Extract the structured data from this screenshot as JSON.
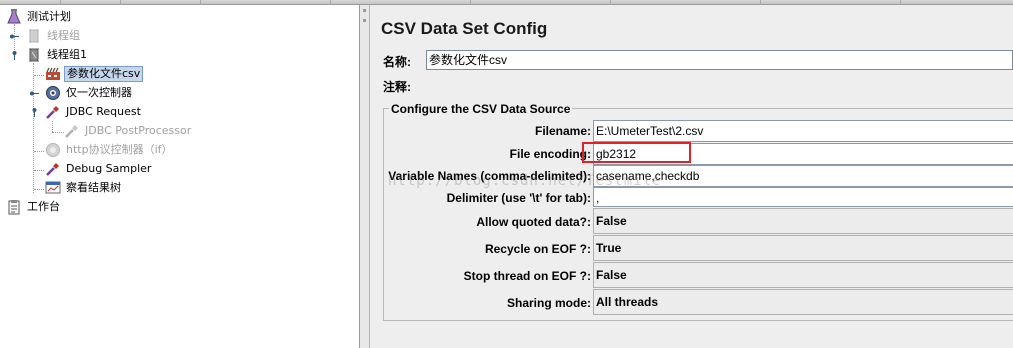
{
  "tree": {
    "nodes": [
      {
        "label": "测试计划",
        "icon": "test-plan-icon",
        "disabled": false,
        "selected": false
      },
      {
        "label": "线程组",
        "icon": "thread-group-icon",
        "disabled": true,
        "selected": false
      },
      {
        "label": "线程组1",
        "icon": "thread-group-icon",
        "disabled": false,
        "selected": false
      },
      {
        "label": "参数化文件csv",
        "icon": "csv-config-icon",
        "disabled": false,
        "selected": true
      },
      {
        "label": "仅一次控制器",
        "icon": "controller-icon",
        "disabled": false,
        "selected": false
      },
      {
        "label": "JDBC Request",
        "icon": "sampler-pipette-icon",
        "disabled": false,
        "selected": false
      },
      {
        "label": "JDBC PostProcessor",
        "icon": "postprocessor-icon",
        "disabled": true,
        "selected": false
      },
      {
        "label": "http协议控制器（if）",
        "icon": "controller-icon",
        "disabled": true,
        "selected": false
      },
      {
        "label": "Debug Sampler",
        "icon": "sampler-pipette-icon",
        "disabled": false,
        "selected": false
      },
      {
        "label": "察看结果树",
        "icon": "listener-icon",
        "disabled": false,
        "selected": false
      },
      {
        "label": "工作台",
        "icon": "workbench-icon",
        "disabled": false,
        "selected": false
      }
    ]
  },
  "config": {
    "title": "CSV Data Set Config",
    "name_label": "名称:",
    "name_value": "参数化文件csv",
    "comment_label": "注释:",
    "comment_value": "",
    "group_title": "Configure the CSV Data Source",
    "filename_label": "Filename:",
    "filename_value": "E:\\UmeterTest\\2.csv",
    "encoding_label": "File encoding:",
    "encoding_value": "gb2312",
    "varnames_label": "Variable Names (comma-delimited):",
    "varnames_value": "casename,checkdb",
    "delimiter_label": "Delimiter (use '\\t' for tab):",
    "delimiter_value": ",",
    "quoted_label": "Allow quoted data?:",
    "quoted_value": "False",
    "recycle_label": "Recycle on EOF ?:",
    "recycle_value": "True",
    "stopthread_label": "Stop thread on EOF ?:",
    "stopthread_value": "False",
    "sharing_label": "Sharing mode:",
    "sharing_value": "All threads"
  },
  "watermark": "http://blog.csdn.net/Testmile",
  "colors": {
    "selection": "#c6d6ec",
    "highlight_box": "#e0232a",
    "panel_bg": "#eeeeee"
  }
}
